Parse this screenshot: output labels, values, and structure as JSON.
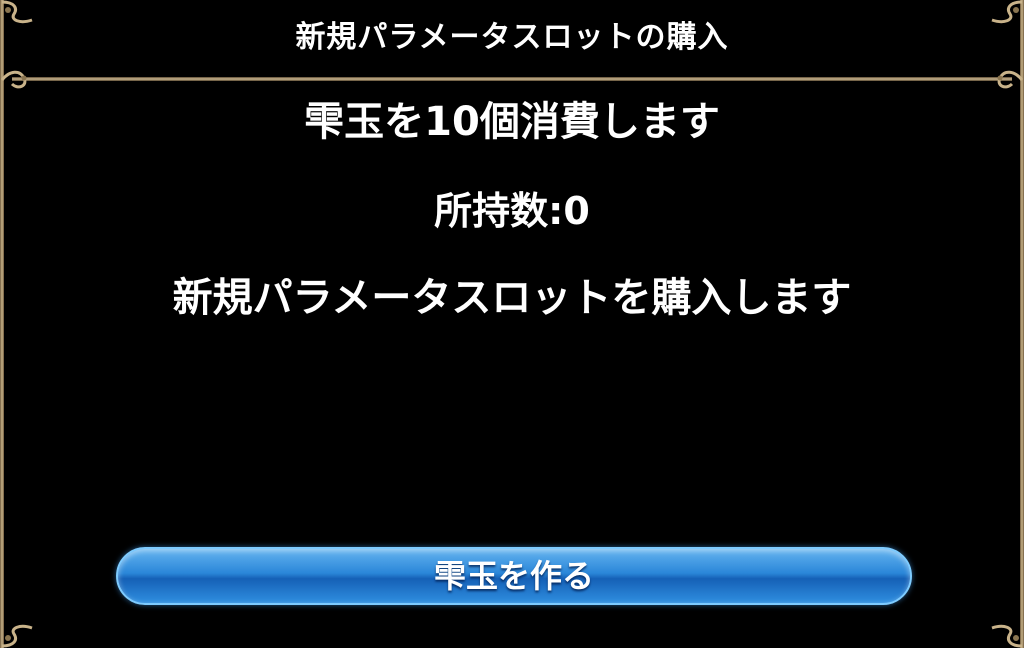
{
  "dialog": {
    "title": "新規パラメータスロットの購入",
    "cost_message": "雫玉を10個消費します",
    "owned_count": "所持数:0",
    "purchase_message": "新規パラメータスロットを購入します",
    "make_button_label": "雫玉を作る"
  },
  "colors": {
    "background": "#000000",
    "frame_bronze": "#c9b38a",
    "button_blue": "#2a86d8",
    "text": "#ffffff"
  }
}
